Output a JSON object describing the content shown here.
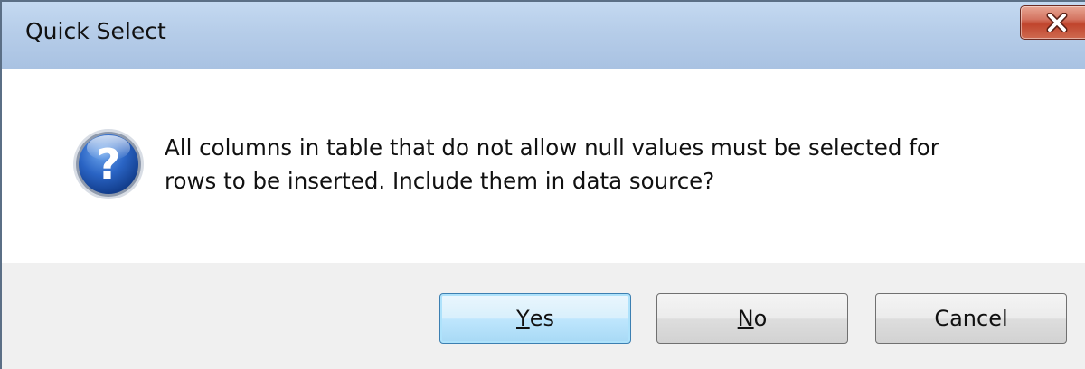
{
  "window": {
    "title": "Quick Select",
    "close_icon": "close-icon"
  },
  "dialog": {
    "icon": "question-icon",
    "message_line1": "All columns in table that do not allow null values must be selected for",
    "message_line2": "rows to be inserted. Include them in data source?"
  },
  "buttons": {
    "yes_mnemonic": "Y",
    "yes_rest": "es",
    "no_mnemonic": "N",
    "no_rest": "o",
    "cancel": "Cancel",
    "default": "Yes"
  },
  "colors": {
    "titlebar": "#b6cde9",
    "close_button": "#c7503a",
    "default_button": "#bee6fd",
    "footer": "#f0f0f0",
    "icon_blue": "#1d55b3"
  }
}
